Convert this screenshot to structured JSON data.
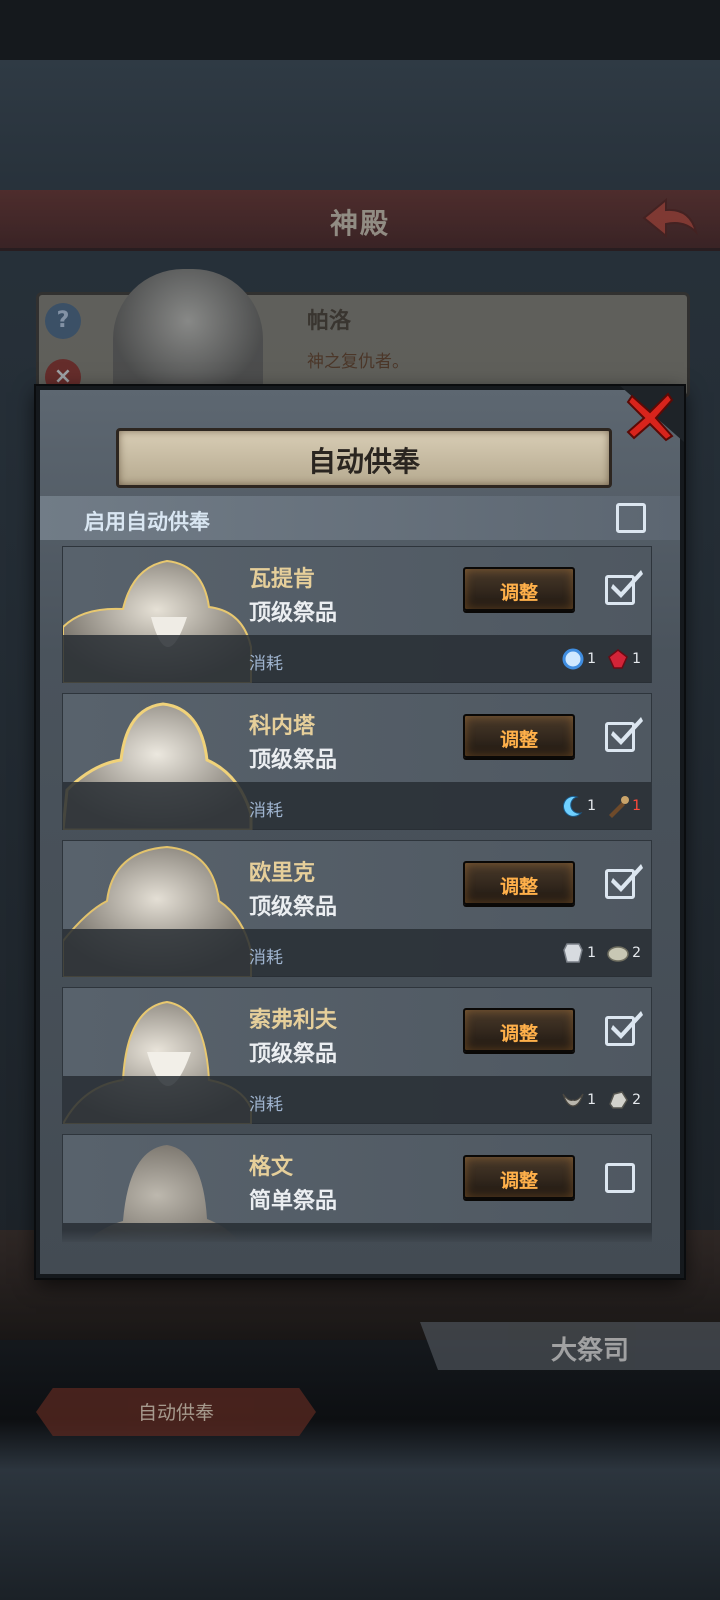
{
  "background": {
    "header_title": "神殿",
    "selected_deity": {
      "name": "帕洛",
      "description": "神之复仇者。"
    },
    "priest_tab": "大祭司",
    "auto_offer_button": "自动供奉"
  },
  "modal": {
    "title": "自动供奉",
    "enable_label": "启用自动供奉",
    "enable_checked": false,
    "deities": [
      {
        "name": "瓦提肯",
        "tier": "顶级祭品",
        "adjust": "调整",
        "checked": true,
        "cost_label": "消耗",
        "costs": [
          {
            "icon": "blue-orb-icon",
            "count": "1",
            "red": false
          },
          {
            "icon": "red-gem-icon",
            "count": "1",
            "red": false
          }
        ]
      },
      {
        "name": "科内塔",
        "tier": "顶级祭品",
        "adjust": "调整",
        "checked": true,
        "cost_label": "消耗",
        "costs": [
          {
            "icon": "crescent-moon-icon",
            "count": "1",
            "red": false
          },
          {
            "icon": "torch-icon",
            "count": "1",
            "red": true
          }
        ]
      },
      {
        "name": "欧里克",
        "tier": "顶级祭品",
        "adjust": "调整",
        "checked": true,
        "cost_label": "消耗",
        "costs": [
          {
            "icon": "armor-icon",
            "count": "1",
            "red": false
          },
          {
            "icon": "stone-icon",
            "count": "2",
            "red": false
          }
        ]
      },
      {
        "name": "索弗利夫",
        "tier": "顶级祭品",
        "adjust": "调整",
        "checked": true,
        "cost_label": "消耗",
        "costs": [
          {
            "icon": "horns-icon",
            "count": "1",
            "red": false
          },
          {
            "icon": "ore-icon",
            "count": "2",
            "red": false
          }
        ]
      },
      {
        "name": "格文",
        "tier": "简单祭品",
        "adjust": "调整",
        "checked": false,
        "cost_label": "消耗",
        "costs": []
      }
    ]
  },
  "colors": {
    "accent_gold": "#e6cf9a",
    "button_text": "#ffb04a",
    "close_red": "#d8241c"
  }
}
